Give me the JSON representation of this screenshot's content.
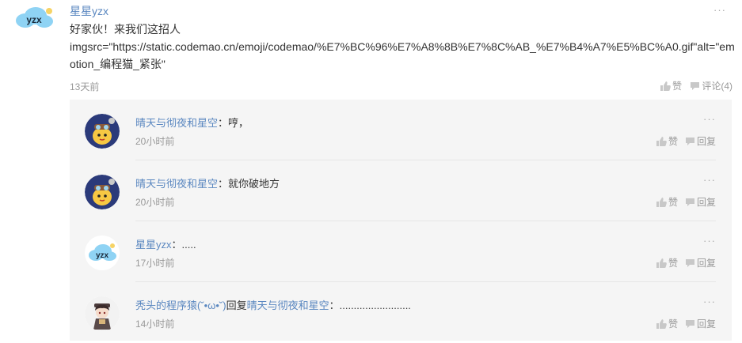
{
  "comment": {
    "author": "星星yzx",
    "text_line1": "好家伙！来我们这招人",
    "text_line2": "imgsrc=\"https://static.codemao.cn/emoji/codemao/%E7%BC%96%E7%A8%8B%E7%8C%AB_%E7%B4%A7%E5%BC%A0.gif\"alt=\"emotion_编程猫_紧张\"",
    "time": "13天前",
    "like_label": "赞",
    "comment_label": "评论(4)",
    "more": "···",
    "avatar_text": "yzx"
  },
  "replies": [
    {
      "author": "晴天与彻夜和星空",
      "sep": "：",
      "text": "哼，",
      "time": "20小时前",
      "like_label": "赞",
      "reply_label": "回复",
      "more": "···"
    },
    {
      "author": "晴天与彻夜和星空",
      "sep": "：",
      "text": "就你破地方",
      "time": "20小时前",
      "like_label": "赞",
      "reply_label": "回复",
      "more": "···"
    },
    {
      "author": "星星yzx",
      "sep": "：",
      "text": ".....",
      "time": "17小时前",
      "like_label": "赞",
      "reply_label": "回复",
      "more": "···",
      "avatar_text": "yzx"
    },
    {
      "author": "秃头的程序猿(˘•ω•˘)",
      "reply_word": "回复",
      "reply_to": "晴天与彻夜和星空",
      "sep": "：",
      "text": ".........................",
      "time": "14小时前",
      "like_label": "赞",
      "reply_label": "回复",
      "more": "···"
    }
  ]
}
